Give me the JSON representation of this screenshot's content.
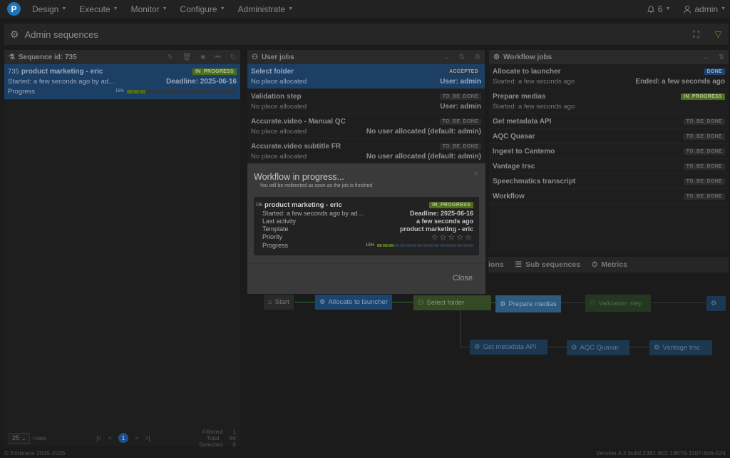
{
  "topbar": {
    "logo": "P",
    "nav": [
      "Design",
      "Execute",
      "Monitor",
      "Configure",
      "Administrate"
    ],
    "notifications_count": "6",
    "user": "admin"
  },
  "page": {
    "title": "Admin sequences"
  },
  "sequence_panel": {
    "header": "Sequence id: 735",
    "item": {
      "id": "735",
      "name": "product marketing - eric",
      "status": "IN_PROGRESS",
      "started": "Started: a few seconds ago by ad…",
      "deadline": "Deadline: 2025-06-16",
      "progress_label": "Progress",
      "progress_pct": "15%",
      "progress_value": 0.15
    },
    "pager": {
      "page_size": "25",
      "rows_label": "rows",
      "page": "1",
      "filtered_label": "Filtered",
      "filtered": "1",
      "total_label": "Total",
      "total": "94",
      "selected_label": "Selected",
      "selected": "0"
    }
  },
  "user_jobs": {
    "header": "User jobs",
    "items": [
      {
        "title": "Select folder",
        "status": "ACCEPTED",
        "sub": "No place allocated",
        "right": "User: admin"
      },
      {
        "title": "Validation step",
        "status": "TO_BE_DONE",
        "sub": "No place allocated",
        "right": "User: admin"
      },
      {
        "title": "Accurate.video - Manual QC",
        "status": "TO_BE_DONE",
        "sub": "No place allocated",
        "right": "No user allocated (default: admin)"
      },
      {
        "title": "Accurate.video subtitle FR",
        "status": "TO_BE_DONE",
        "sub": "No place allocated",
        "right": "No user allocated (default: admin)"
      }
    ]
  },
  "workflow_jobs": {
    "header": "Workflow jobs",
    "items": [
      {
        "title": "Allocate to launcher",
        "status": "DONE",
        "sub": "Started: a few seconds ago",
        "right": "Ended: a few seconds ago"
      },
      {
        "title": "Prepare medias",
        "status": "IN_PROGRESS",
        "sub": "Started: a few seconds ago",
        "right": ""
      },
      {
        "title": "Get metadata API",
        "status": "TO_BE_DONE"
      },
      {
        "title": "AQC Quasar",
        "status": "TO_BE_DONE"
      },
      {
        "title": "Ingest to Cantemo",
        "status": "TO_BE_DONE"
      },
      {
        "title": "Vantage trsc",
        "status": "TO_BE_DONE"
      },
      {
        "title": "Speechmatics transcript",
        "status": "TO_BE_DONE"
      },
      {
        "title": "Workflow",
        "status": "TO_BE_DONE"
      }
    ]
  },
  "tabs": {
    "partial": "ions",
    "sub_sequences": "Sub sequences",
    "metrics": "Metrics"
  },
  "graph": {
    "start": "Start",
    "allocate": "Allocate to launcher",
    "select": "Select folder",
    "prepare": "Prepare medias",
    "validation": "Validation step",
    "get_metadata": "Get metadata API",
    "aqc": "AQC Quasar",
    "vantage": "Vantage trsc"
  },
  "modal": {
    "title": "Workflow in progress...",
    "subtitle": "You will be redirected as soon as the job is finished",
    "id": "735",
    "name": "product marketing - eric",
    "status": "IN_PROGRESS",
    "started": "Started: a few seconds ago by ad…",
    "deadline": "Deadline: 2025-06-16",
    "last_activity_label": "Last activity",
    "last_activity": "a few seconds ago",
    "template_label": "Template",
    "template": "product marketing - eric",
    "priority_label": "Priority",
    "progress_label": "Progress",
    "progress_pct": "15%",
    "progress_value": 0.15,
    "close": "Close"
  },
  "footer": {
    "copyright": "© Embrace 2015-2025",
    "version": "Version 4.2 build 2381.902.19670-1107-846-524"
  },
  "colors": {
    "accent": "#1f74b8",
    "in_progress": "#4e6e1a",
    "done": "#1f4472",
    "filter": "#9a7b10"
  }
}
